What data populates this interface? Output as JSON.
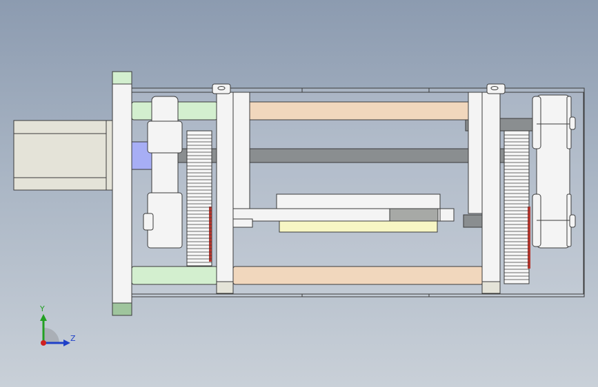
{
  "viewport": {
    "background_top": "#8c9bb0",
    "background_bottom": "#c9d0d8"
  },
  "colors": {
    "frame": "#d9dde3",
    "part_face": "#f4f4f4",
    "motor": "#e4e3d8",
    "rod_tan": "#f1d7bd",
    "rod_green": "#d3efcf",
    "shaft_grey": "#8a8e90",
    "shaft_blue": "#a7aef5",
    "gear": "#f6f6f6",
    "block_yellow": "#f7f6c4",
    "mount_green": "#9fc59d",
    "edge": "#3a3a3a",
    "accent_red": "#b4352d"
  },
  "orientation_triad": {
    "icon": "view-orientation-triad-icon",
    "y_label": "Y",
    "z_label": "Z",
    "y_color": "#22a022",
    "z_color": "#1f40c8",
    "x_color": "#d02020"
  }
}
